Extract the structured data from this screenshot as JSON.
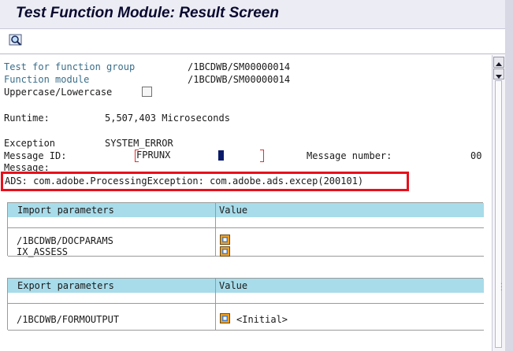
{
  "window": {
    "title": "Test Function Module: Result Screen"
  },
  "toolbar": {
    "buttons": [
      {
        "icon": "magnifier-icon"
      }
    ]
  },
  "fields": {
    "function_group_label": "Test for function group",
    "function_group_value": "/1BCDWB/SM00000014",
    "function_module_label": "Function module",
    "function_module_value": "/1BCDWB/SM00000014",
    "uppercase_label": "Uppercase/Lowercase",
    "uppercase_checked": false,
    "runtime_label": "Runtime:",
    "runtime_value": "5,507,403 Microseconds",
    "exception_label": "Exception",
    "exception_value": "SYSTEM_ERROR",
    "message_id_label": "Message ID:",
    "message_id_value": "FPRUNX",
    "message_number_label": "Message number:",
    "message_number_value": "00",
    "message_label": "Message:",
    "message_text": "ADS: com.adobe.ProcessingException: com.adobe.ads.excep(200101)"
  },
  "import_table": {
    "col1": "Import parameters",
    "col2": "Value",
    "rows": [
      "/1BCDWB/DOCPARAMS",
      "IX_ASSESS"
    ]
  },
  "export_table": {
    "col1": "Export parameters",
    "col2": "Value",
    "rows": [
      {
        "name": "/1BCDWB/FORMOUTPUT",
        "value": "<Initial>"
      }
    ]
  },
  "colors": {
    "highlight_border": "#e8101a",
    "table_header": "#a8dcea",
    "label_blue": "#3a6e8a"
  }
}
